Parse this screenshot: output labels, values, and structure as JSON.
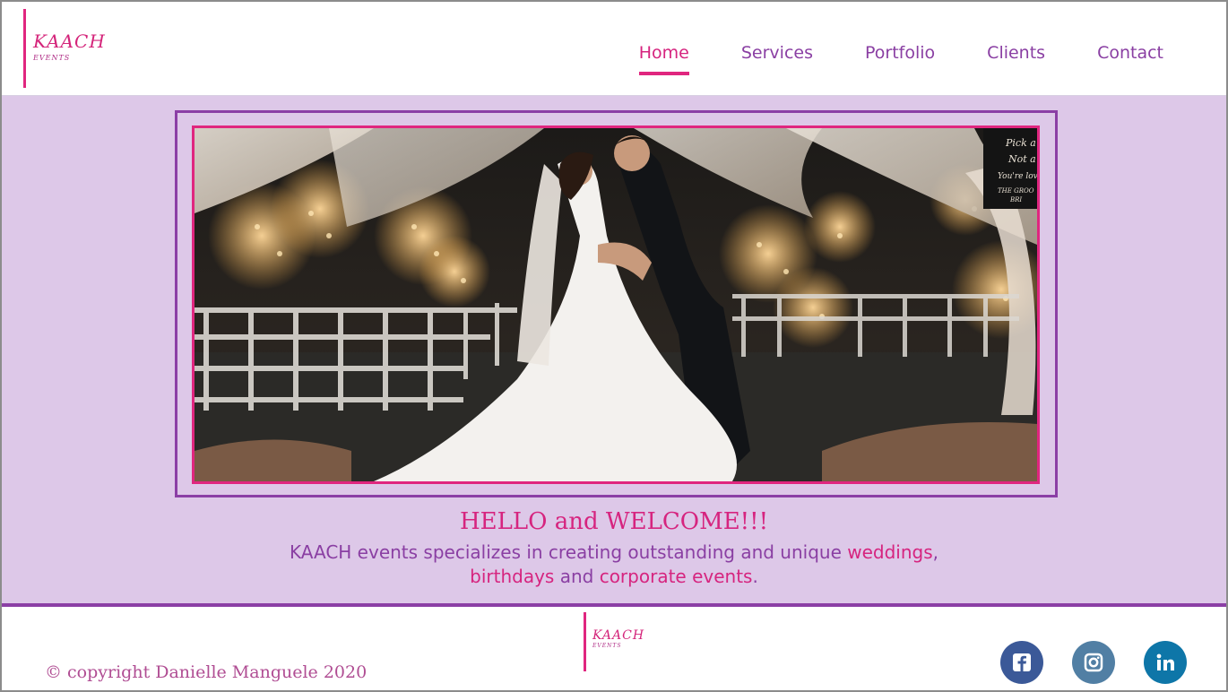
{
  "brand": {
    "logo_main": "KAACH",
    "logo_sub": "EVENTS"
  },
  "nav": {
    "items": [
      {
        "label": "Home",
        "active": true
      },
      {
        "label": "Services",
        "active": false
      },
      {
        "label": "Portfolio",
        "active": false
      },
      {
        "label": "Clients",
        "active": false
      },
      {
        "label": "Contact",
        "active": false
      }
    ]
  },
  "hero": {
    "sign_lines": [
      "Pick a",
      "Not a",
      "You're lov",
      "THE GROO",
      "BRI"
    ]
  },
  "welcome": {
    "heading": "HELLO and WELCOME!!!",
    "intro_text_1": "KAACH events specializes in creating outstanding and unique ",
    "intro_hl_1": "weddings",
    "intro_text_2": ",",
    "intro_hl_2": "birthdays",
    "intro_text_3": " and ",
    "intro_hl_3": "corporate events",
    "intro_text_4": "."
  },
  "footer": {
    "copyright": "© copyright Danielle Manguele 2020",
    "social": [
      {
        "icon": "facebook-icon",
        "color": "#3b5998"
      },
      {
        "icon": "instagram-icon",
        "color": "#517fa4"
      },
      {
        "icon": "linkedin-icon",
        "color": "#0e76a8"
      }
    ]
  },
  "colors": {
    "accent_pink": "#e0267f",
    "accent_purple": "#8b3fa5",
    "main_bg": "#ddc8e8"
  }
}
